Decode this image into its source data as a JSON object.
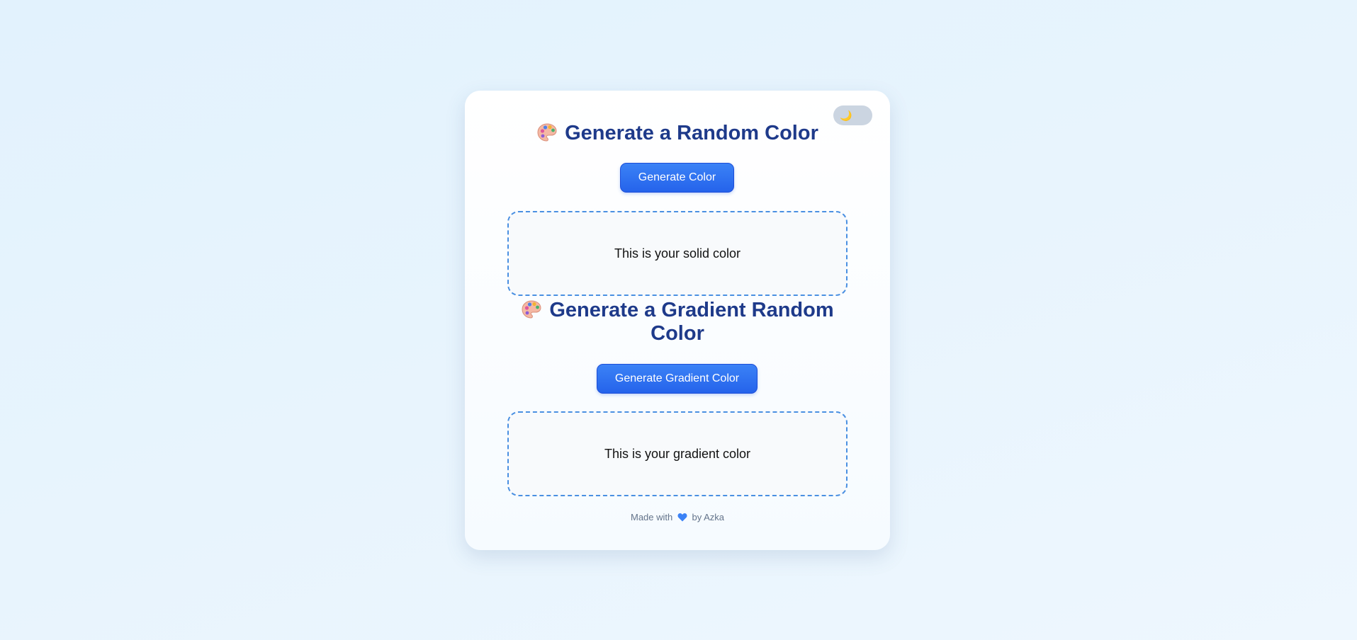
{
  "theme_toggle": {
    "icon": "moon-icon",
    "glyph": "🌙"
  },
  "solid": {
    "title": "Generate a Random Color",
    "title_icon": "palette-icon",
    "button_label": "Generate Color",
    "preview_text": "This is your solid color"
  },
  "gradient": {
    "title": "Generate a Gradient Random Color",
    "title_icon": "palette-icon",
    "button_label": "Generate Gradient Color",
    "preview_text": "This is your gradient color"
  },
  "footer": {
    "prefix": "Made with",
    "icon": "blue-heart-icon",
    "suffix": "by Azka"
  },
  "colors": {
    "accent": "#2563eb",
    "heading": "#1e3a8a",
    "dashed_border": "#4a90e2",
    "toggle_bg": "#cbd5e1"
  }
}
